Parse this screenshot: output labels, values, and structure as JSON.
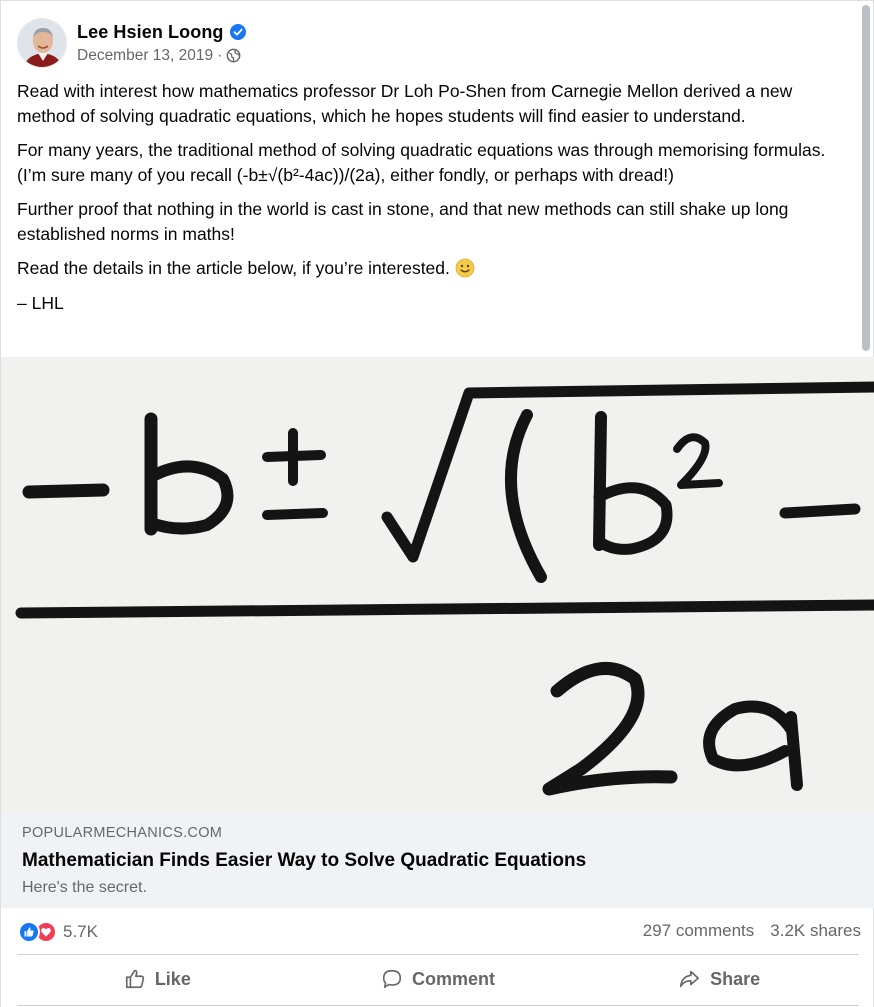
{
  "post": {
    "author": "Lee Hsien Loong",
    "date": "December 13, 2019",
    "date_separator": "·",
    "icons": {
      "verified": "verified-badge-icon",
      "audience": "globe-icon"
    },
    "paragraphs": [
      "Read with interest how mathematics professor Dr Loh Po-Shen from Carnegie Mellon derived a new method of solving quadratic equations, which he hopes students will find easier to understand.",
      "For many years, the traditional method of solving quadratic equations was through memorising formulas. (I’m sure many of you recall (-b±√(b²-4ac))/(2a), either fondly, or perhaps with dread!)",
      "Further proof that nothing in the world is cast in stone, and that new methods can still shake up long established norms in maths!",
      "Read the details in the article below, if you’re interested.",
      "– LHL"
    ],
    "emoji": "slightly-smiling-face-icon"
  },
  "link_preview": {
    "domain": "POPULARMECHANICS.COM",
    "title": "Mathematician Finds Easier Way to Solve Quadratic Equations",
    "subtitle": "Here's the secret."
  },
  "engagement": {
    "reaction_icons": [
      "like-reaction-icon",
      "love-reaction-icon"
    ],
    "reaction_count": "5.7K",
    "comments": "297 comments",
    "shares": "3.2K shares"
  },
  "actions": [
    {
      "label": "Like",
      "icon": "thumbs-up-icon"
    },
    {
      "label": "Comment",
      "icon": "comment-bubble-icon"
    },
    {
      "label": "Share",
      "icon": "share-arrow-icon"
    }
  ],
  "colors": {
    "text": "#050505",
    "secondary_text": "#65676b",
    "verified_blue": "#1877f2",
    "love_red": "#f33e58",
    "link_card_bg": "#f0f2f5"
  }
}
